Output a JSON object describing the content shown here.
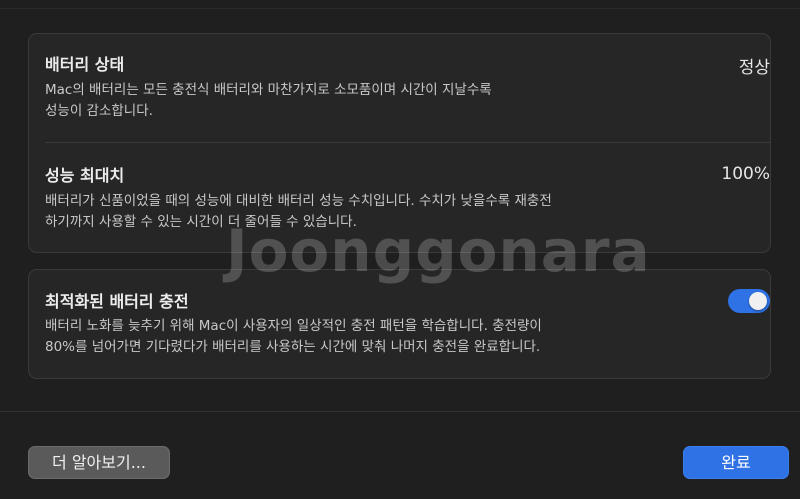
{
  "battery_health": {
    "title": "배터리 상태",
    "value": "정상",
    "desc_line1": "Mac의 배터리는 모든 충전식 배터리와 마찬가지로 소모품이며 시간이 지날수록",
    "desc_line2": "성능이 감소합니다."
  },
  "max_capacity": {
    "title": "성능 최대치",
    "value": "100%",
    "desc_line1": "배터리가 신품이었을 때의 성능에 대비한 배터리 성능 수치입니다. 수치가 낮을수록 재충전",
    "desc_line2": "하기까지 사용할 수 있는 시간이 더 줄어들 수 있습니다."
  },
  "optimized_charging": {
    "title": "최적화된 배터리 충전",
    "enabled": true,
    "desc_line1": "배터리 노화를 늦추기 위해 Mac이 사용자의 일상적인 충전 패턴을 학습합니다. 충전량이",
    "desc_line2": "80%를 넘어가면 기다렸다가 배터리를 사용하는 시간에 맞춰 나머지 충전을 완료합니다."
  },
  "buttons": {
    "learn_more": "더 알아보기...",
    "done": "완료"
  },
  "watermark": "Joonggonara",
  "colors": {
    "accent": "#2f72e6",
    "background": "#1f1f1f",
    "card": "#262626"
  }
}
